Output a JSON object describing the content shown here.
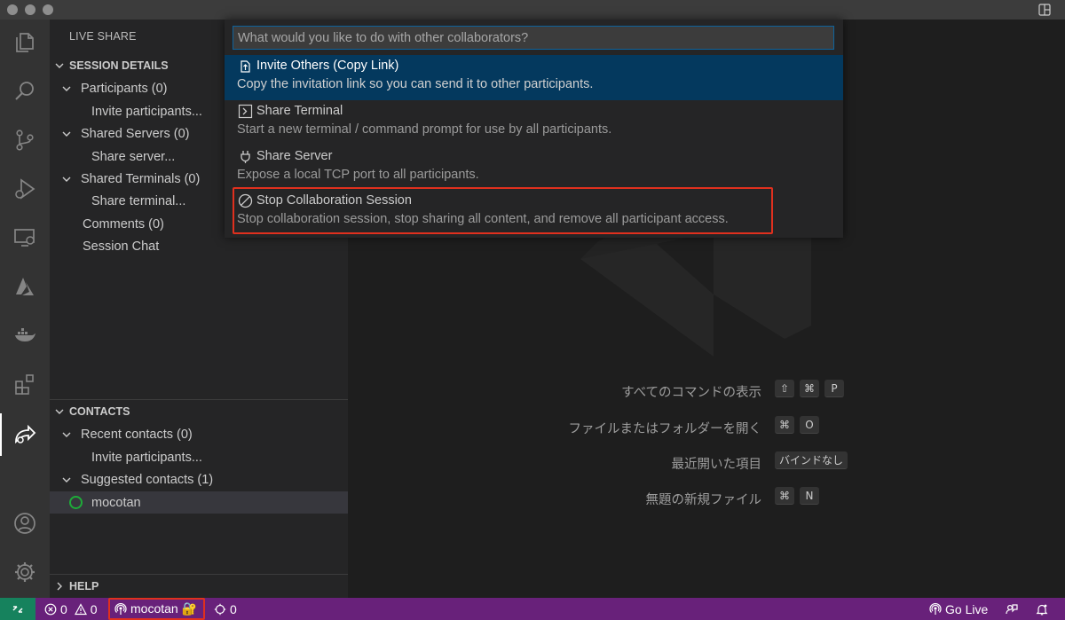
{
  "colors": {
    "accent": "#0e639c",
    "statusbar": "#68217a",
    "remote_indicator": "#16825d",
    "highlight": "#e0301e",
    "online": "#1eab39"
  },
  "sidebar": {
    "view_title": "LIVE SHARE",
    "session_details": {
      "header": "SESSION DETAILS",
      "items": [
        {
          "label": "Participants (0)"
        },
        {
          "label": "Invite participants..."
        },
        {
          "label": "Shared Servers (0)"
        },
        {
          "label": "Share server..."
        },
        {
          "label": "Shared Terminals (0)"
        },
        {
          "label": "Share terminal..."
        },
        {
          "label": "Comments (0)"
        },
        {
          "label": "Session Chat"
        }
      ]
    },
    "contacts": {
      "header": "CONTACTS",
      "items": [
        {
          "label": "Recent contacts (0)"
        },
        {
          "label": "Invite participants..."
        },
        {
          "label": "Suggested contacts (1)"
        },
        {
          "label": "mocotan",
          "icon": "online-status-icon"
        }
      ]
    },
    "help": {
      "header": "HELP"
    }
  },
  "activity_bar": {
    "icons": [
      "explorer-icon",
      "search-icon",
      "source-control-icon",
      "run-debug-icon",
      "remote-explorer-icon",
      "azure-icon",
      "docker-icon",
      "extensions-icon",
      "live-share-icon",
      "accounts-icon",
      "settings-gear-icon"
    ],
    "active": "live-share-icon"
  },
  "palette": {
    "placeholder": "What would you like to do with other collaborators?",
    "items": [
      {
        "icon": "invite-copy-link-icon",
        "title": "Invite Others (Copy Link)",
        "description": "Copy the invitation link so you can send it to other participants."
      },
      {
        "icon": "terminal-icon",
        "title": "Share Terminal",
        "description": "Start a new terminal / command prompt for use by all participants."
      },
      {
        "icon": "plug-icon",
        "title": "Share Server",
        "description": "Expose a local TCP port to all participants."
      },
      {
        "icon": "circle-slash-icon",
        "title": "Stop Collaboration Session",
        "description": "Stop collaboration session, stop sharing all content, and remove all participant access."
      }
    ],
    "selected_index": 0,
    "highlighted_index": 3
  },
  "editor": {
    "watermark": "vscode-logo-icon",
    "shortcuts": [
      {
        "label": "すべてのコマンドの表示",
        "keys": [
          "⇧",
          "⌘",
          "P"
        ]
      },
      {
        "label": "ファイルまたはフォルダーを開く",
        "keys": [
          "⌘",
          "O"
        ]
      },
      {
        "label": "最近開いた項目",
        "keys": [
          "バインドなし"
        ]
      },
      {
        "label": "無題の新規ファイル",
        "keys": [
          "⌘",
          "N"
        ]
      }
    ]
  },
  "statusbar": {
    "errors": "0",
    "warnings": "0",
    "live_share_user": "mocotan 🔐",
    "participants": "0",
    "go_live": "Go Live"
  }
}
